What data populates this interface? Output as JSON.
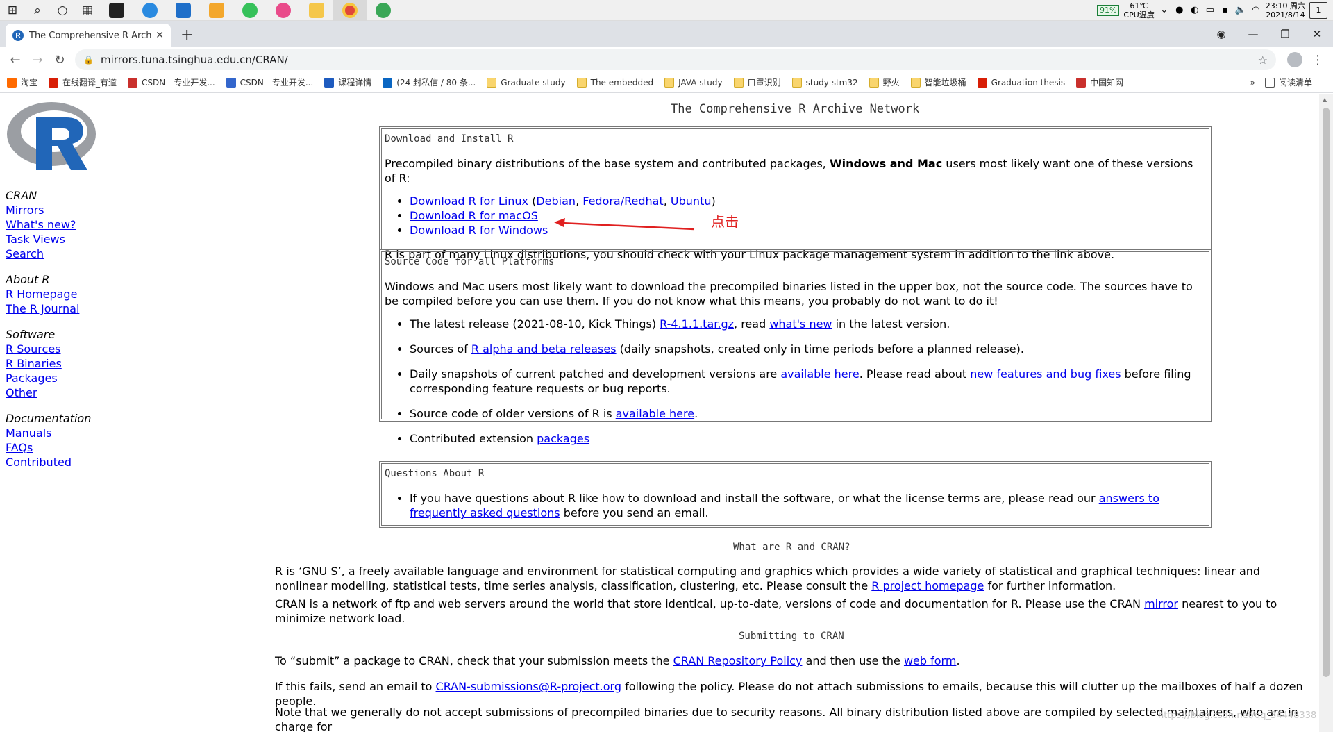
{
  "taskbar": {
    "battery": "91%",
    "temp": "61℃",
    "temp_label": "CPU温度",
    "time": "23:10 周六",
    "date": "2021/8/14",
    "notif_count": "1"
  },
  "browser": {
    "tab_title": "The Comprehensive R Archive",
    "new_tab": "+",
    "url": "mirrors.tuna.tsinghua.edu.cn/CRAN/"
  },
  "bookmarks": [
    "淘宝",
    "在线翻译_有道",
    "CSDN - 专业开发...",
    "CSDN - 专业开发...",
    "课程详情",
    "(24 封私信 / 80 条...",
    "Graduate study",
    "The embedded",
    "JAVA study",
    "口罩识别",
    "study stm32",
    "野火",
    "智能垃圾桶",
    "Graduation thesis",
    "中国知网"
  ],
  "bookmarks_right": "阅读清单",
  "page": {
    "title": "The Comprehensive R Archive Network",
    "sidebar": [
      {
        "head": "CRAN",
        "links": [
          "Mirrors",
          "What's new?",
          "Task Views",
          "Search"
        ]
      },
      {
        "head": "About R",
        "links": [
          "R Homepage",
          "The R Journal"
        ]
      },
      {
        "head": "Software",
        "links": [
          "R Sources",
          "R Binaries",
          "Packages",
          "Other"
        ]
      },
      {
        "head": "Documentation",
        "links": [
          "Manuals",
          "FAQs",
          "Contributed"
        ]
      }
    ],
    "download_box": {
      "head": "Download and Install R",
      "intro_pre": "Precompiled binary distributions of the base system and contributed packages, ",
      "intro_bold": "Windows and Mac",
      "intro_post": " users most likely want one of these versions of R:",
      "linux": "Download R for Linux",
      "debian": "Debian",
      "fedora": "Fedora/Redhat",
      "ubuntu": "Ubuntu",
      "macos": "Download R for macOS",
      "windows": "Download R for Windows",
      "note": "R is part of many Linux distributions, you should check with your Linux package management system in addition to the link above."
    },
    "annotation": "点击",
    "source_box": {
      "head": "Source Code for all Platforms",
      "intro": "Windows and Mac users most likely want to download the precompiled binaries listed in the upper box, not the source code. The sources have to be compiled before you can use them. If you do not know what this means, you probably do not want to do it!",
      "item1_pre": "The latest release (2021-08-10, Kick Things) ",
      "item1_link1": "R-4.1.1.tar.gz",
      "item1_mid": ", read ",
      "item1_link2": "what's new",
      "item1_post": " in the latest version.",
      "item2_pre": "Sources of ",
      "item2_link": "R alpha and beta releases",
      "item2_post": " (daily snapshots, created only in time periods before a planned release).",
      "item3_pre": "Daily snapshots of current patched and development versions are ",
      "item3_link1": "available here",
      "item3_mid": ". Please read about ",
      "item3_link2": "new features and bug fixes",
      "item3_post": " before filing corresponding feature requests or bug reports.",
      "item4_pre": "Source code of older versions of R is ",
      "item4_link": "available here",
      "item4_post": ".",
      "item5_pre": "Contributed extension ",
      "item5_link": "packages"
    },
    "questions_box": {
      "head": "Questions About R",
      "item_pre": "If you have questions about R like how to download and install the software, or what the license terms are, please read our ",
      "item_link": "answers to frequently asked questions",
      "item_post": " before you send an email."
    },
    "what_head": "What are R and CRAN?",
    "what_p1_pre": "R is ‘GNU S’, a freely available language and environment for statistical computing and graphics which provides a wide variety of statistical and graphical techniques: linear and nonlinear modelling, statistical tests, time series analysis, classification, clustering, etc. Please consult the ",
    "what_p1_link": "R project homepage",
    "what_p1_post": " for further information.",
    "what_p2_pre": "CRAN is a network of ftp and web servers around the world that store identical, up-to-date, versions of code and documentation for R. Please use the CRAN ",
    "what_p2_link": "mirror",
    "what_p2_post": " nearest to you to minimize network load.",
    "submit_head": "Submitting to CRAN",
    "sub_p1_pre": "To “submit” a package to CRAN, check that your submission meets the ",
    "sub_p1_link1": "CRAN Repository Policy",
    "sub_p1_mid": " and then use the ",
    "sub_p1_link2": "web form",
    "sub_p1_post": ".",
    "sub_p2_pre": "If this fails, send an email to ",
    "sub_p2_link": "CRAN-submissions@R-project.org",
    "sub_p2_post": " following the policy. Please do not attach submissions to emails, because this will clutter up the mailboxes of half a dozen people.",
    "sub_p3": "Note that we generally do not accept submissions of precompiled binaries due to security reasons. All binary distribution listed above are compiled by selected maintainers, who are in charge for",
    "watermark": "https://blog.csdn.net/qq_34448338"
  },
  "colors": {
    "link": "#0000ee",
    "annotation": "#e02020",
    "r_blue": "#2166b8",
    "r_grey": "#9b9ea3"
  }
}
